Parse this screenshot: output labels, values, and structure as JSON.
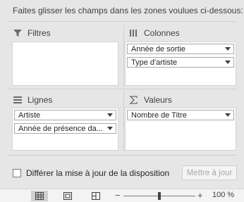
{
  "header": {
    "instruction": "Faites glisser les champs dans les zones voulues ci-dessous:"
  },
  "zones": {
    "filters": {
      "label": "Filtres",
      "icon": "filter-icon",
      "fields": []
    },
    "columns": {
      "label": "Colonnes",
      "icon": "columns-icon",
      "fields": [
        "Année de sortie",
        "Type d'artiste"
      ]
    },
    "rows": {
      "label": "Lignes",
      "icon": "rows-icon",
      "fields": [
        "Artiste",
        "Année de présence da..."
      ]
    },
    "values": {
      "label": "Valeurs",
      "icon": "sigma-icon",
      "fields": [
        "Nombre de Titre"
      ]
    }
  },
  "footer": {
    "defer_label": "Différer la mise à jour de la disposition",
    "defer_checked": false,
    "update_button": "Mettre à jour"
  },
  "statusbar": {
    "views": [
      "normal-view-icon",
      "page-layout-icon",
      "page-break-icon"
    ],
    "zoom_minus": "−",
    "zoom_plus": "+",
    "zoom": "100 %",
    "zoom_fraction": 0.5
  },
  "colors": {
    "panel_bg": "#e6e6e6",
    "box_bg": "#ffffff",
    "disabled_text": "#a8a8a8"
  }
}
